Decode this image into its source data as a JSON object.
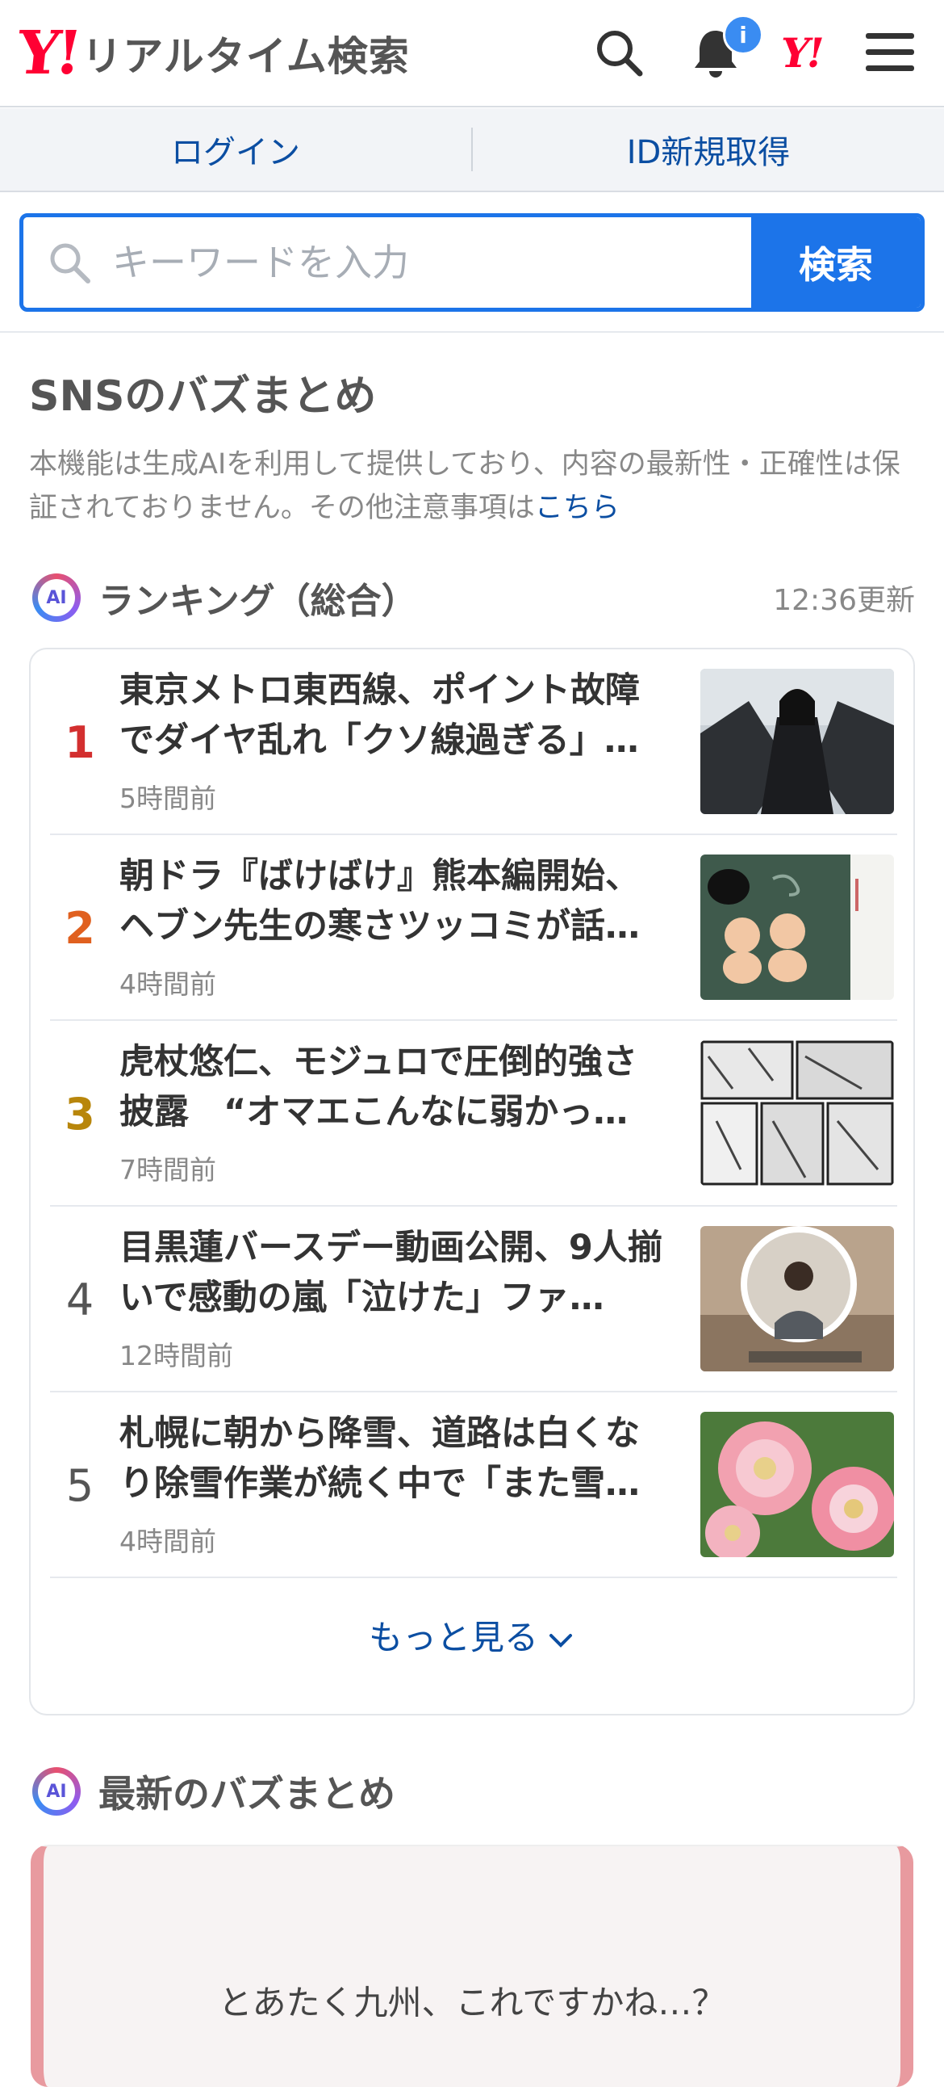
{
  "header": {
    "logo_mark": "Y!",
    "logo_text": "リアルタイム検索",
    "notification_badge": "i",
    "yahoo_mark": "Y!",
    "icons": [
      "search-icon",
      "bell-icon",
      "menu-icon"
    ]
  },
  "auth": {
    "login": "ログイン",
    "signup": "ID新規取得"
  },
  "search": {
    "placeholder": "キーワードを入力",
    "button": "検索"
  },
  "section": {
    "title": "SNSのバズまとめ",
    "disclaimer": "本機能は生成AIを利用して提供しており、内容の最新性・正確性は保証されておりません。その他注意事項は",
    "disclaimer_link": "こちら"
  },
  "ranking": {
    "ai_label": "AI",
    "title": "ランキング（総合）",
    "updated": "12:36更新",
    "items": [
      {
        "rank": "1",
        "headline": "東京メトロ東西線、ポイント故障でダイヤ乱れ「クソ線過ぎる」…",
        "time": "5時間前"
      },
      {
        "rank": "2",
        "headline": "朝ドラ『ばけばけ』熊本編開始、ヘブン先生の寒さツッコミが話…",
        "time": "4時間前"
      },
      {
        "rank": "3",
        "headline": "虎杖悠仁、モジュロで圧倒的強さ披露　“オマエこんなに弱かっ…",
        "time": "7時間前"
      },
      {
        "rank": "4",
        "headline": "目黒蓮バースデー動画公開、9人揃いで感動の嵐「泣けた」ファ…",
        "time": "12時間前"
      },
      {
        "rank": "5",
        "headline": "札幌に朝から降雪、道路は白くなり除雪作業が続く中で「また雪…",
        "time": "4時間前"
      }
    ],
    "more": "もっと見る"
  },
  "latest": {
    "ai_label": "AI",
    "title": "最新のバズまとめ",
    "quote": "とあたく九州、これですかね…？"
  },
  "colors": {
    "brand_red": "#ff0033",
    "accent_blue": "#1c74e9",
    "link_blue": "#0b4ea2"
  }
}
